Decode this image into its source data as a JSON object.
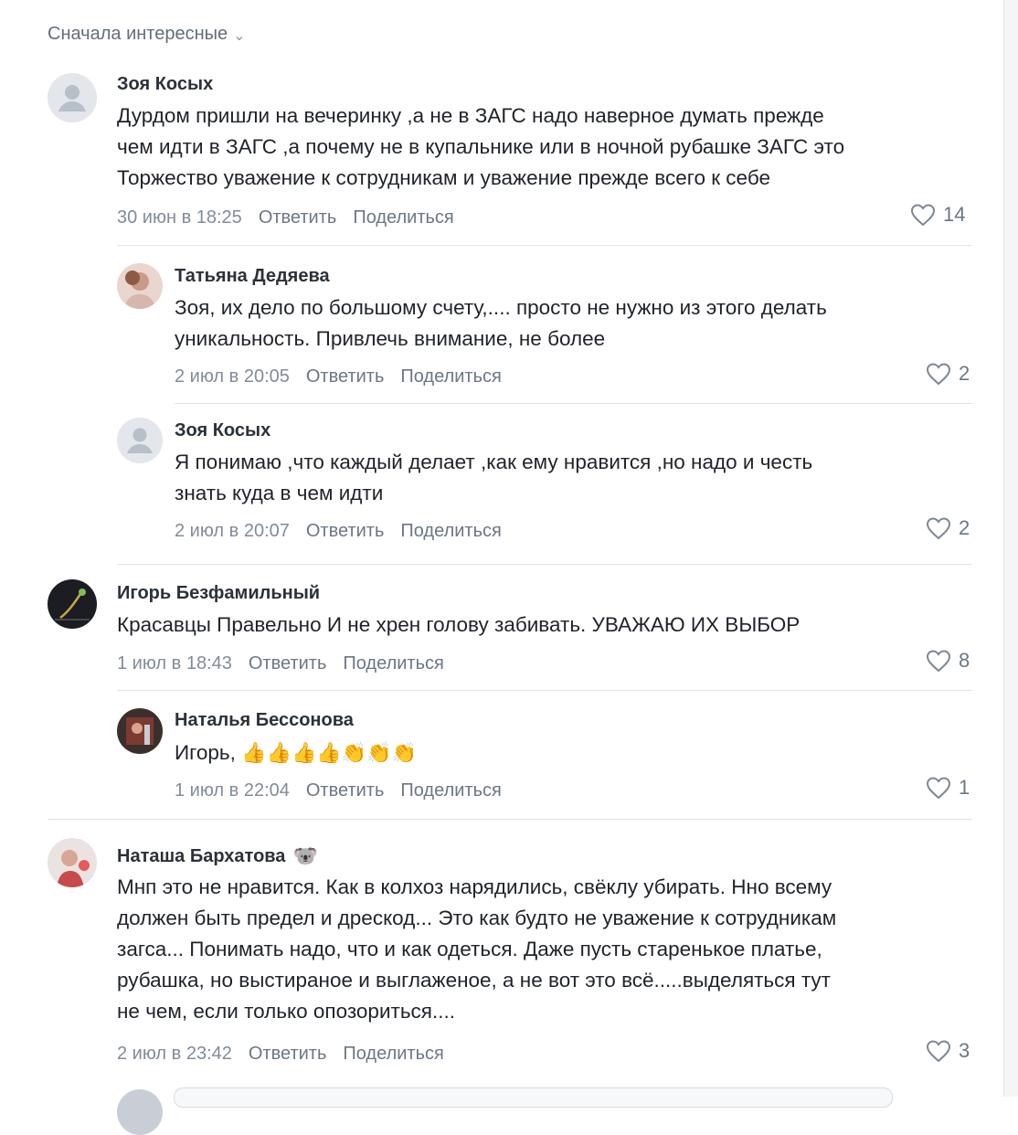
{
  "sort_label": "Сначала интересные",
  "actions": {
    "reply": "Ответить",
    "share": "Поделиться"
  },
  "comments": [
    {
      "author": "Зоя Косых",
      "lines": [
        "Дурдом пришли на вечеринку ,а не в ЗАГС надо наверное думать прежде",
        "чем идти в ЗАГС ,а почему не в купальнике или в ночной рубашке ЗАГС это",
        "Торжество уважение к сотрудникам и уважение прежде всего к себе"
      ],
      "date": "30 июн в 18:25",
      "likes": "14"
    },
    {
      "author": "Татьяна Дедяева",
      "lines": [
        "Зоя, их дело по большому счету,.... просто не нужно из этого делать",
        "уникальность. Привлечь внимание, не более"
      ],
      "date": "2 июл в 20:05",
      "likes": "2"
    },
    {
      "author": "Зоя Косых",
      "lines": [
        "Я понимаю ,что каждый делает ,как ему нравится ,но надо и честь",
        "знать куда в чем идти"
      ],
      "date": "2 июл в 20:07",
      "likes": "2"
    },
    {
      "author": "Игорь Безфамильный",
      "lines": [
        "Красавцы Правельно И не хрен голову забивать. УВАЖАЮ ИХ ВЫБОР"
      ],
      "date": "1 июл в 18:43",
      "likes": "8"
    },
    {
      "author": "Наталья Бессонова",
      "lines": [
        "Игорь,"
      ],
      "emoji": "👍👍👍👍👏👏👏",
      "date": "1 июл в 22:04",
      "likes": "1"
    },
    {
      "author": "Наташа Бархатова",
      "badge": "🐨",
      "lines": [
        "Мнп это не нравится. Как в колхоз нарядились, свёклу убирать. Нно всему",
        "должен быть предел и дрескод... Это как будто не уважение к сотрудникам",
        "загса... Понимать надо, что и как одеться. Даже пусть старенькое платье,",
        "рубашка, но выстираное и выглаженое, а не вот это всё.....выделяться тут",
        "не чем, если только опозориться...."
      ],
      "date": "2 июл в 23:42",
      "likes": "3"
    }
  ]
}
